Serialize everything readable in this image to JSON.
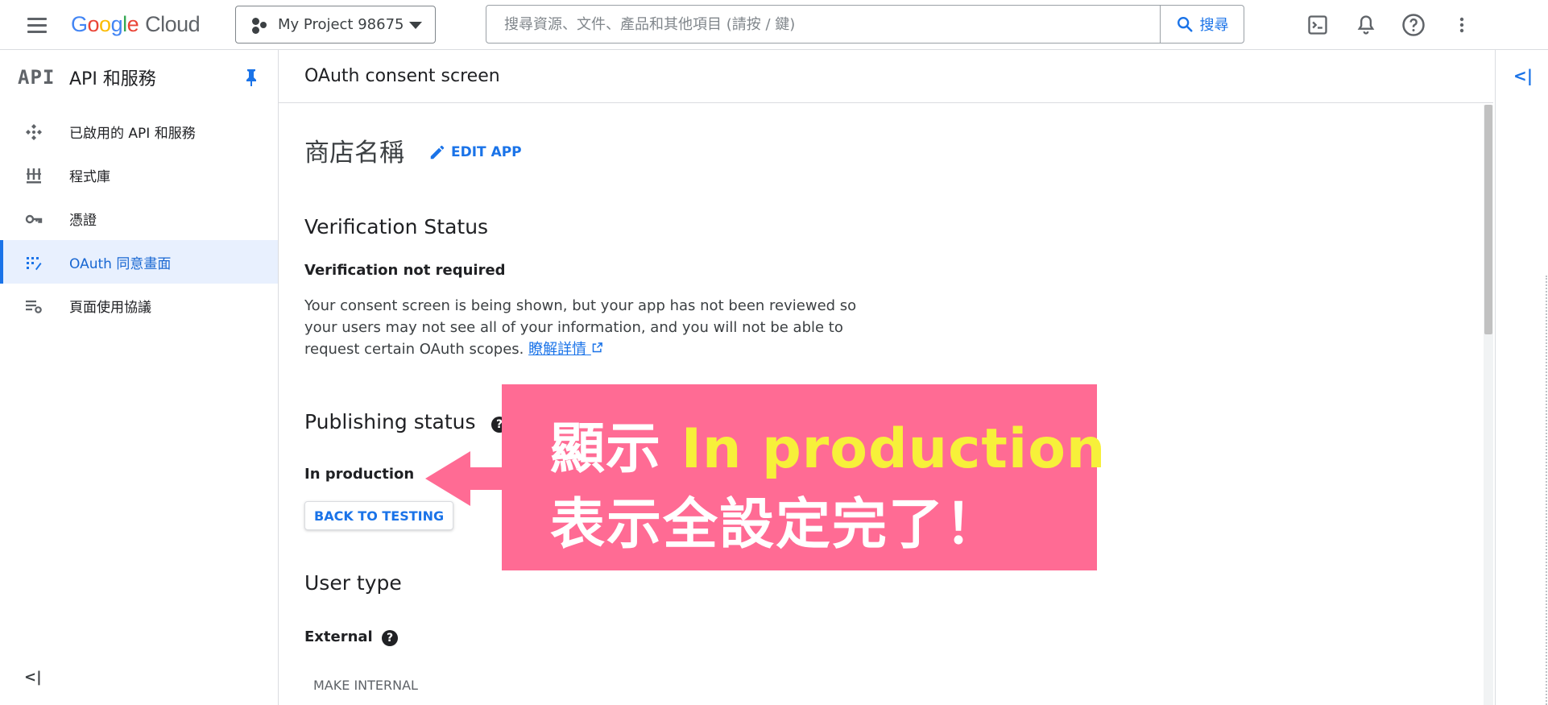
{
  "topbar": {
    "logo_google": "Google",
    "logo_cloud": "Cloud",
    "project_name": "My Project 98675",
    "search_placeholder": "搜尋資源、文件、產品和其他項目 (請按 / 鍵)",
    "search_button_label": "搜尋"
  },
  "sidebar": {
    "logo": "API",
    "title": "API 和服務",
    "items": [
      {
        "label": "已啟用的 API 和服務",
        "icon": "api-services-icon"
      },
      {
        "label": "程式庫",
        "icon": "library-icon"
      },
      {
        "label": "憑證",
        "icon": "key-icon"
      },
      {
        "label": "OAuth 同意畫面",
        "icon": "oauth-consent-icon",
        "active": true
      },
      {
        "label": "頁面使用協議",
        "icon": "page-usage-settings-icon"
      }
    ]
  },
  "main": {
    "title": "OAuth consent screen",
    "app_name": "商店名稱",
    "edit_app_label": "EDIT APP",
    "verification_heading": "Verification Status",
    "verification_status": "Verification not required",
    "verification_text": "Your consent screen is being shown, but your app has not been reviewed so your users may not see all of your information, and you will not be able to request certain OAuth scopes.",
    "learn_more": "瞭解詳情",
    "publishing_heading": "Publishing status",
    "publishing_value": "In production",
    "back_to_testing": "BACK TO TESTING",
    "user_type_heading": "User type",
    "user_type_value": "External",
    "make_internal": "MAKE INTERNAL"
  },
  "annotation": {
    "line1_prefix": "顯示 ",
    "line1_highlight": "In production",
    "line2": "表示全設定完了！",
    "bg_color": "#ff6b94",
    "highlight_color": "#f7f03a"
  },
  "colors": {
    "accent": "#1a73e8",
    "active_bg": "#e8f0fe"
  }
}
